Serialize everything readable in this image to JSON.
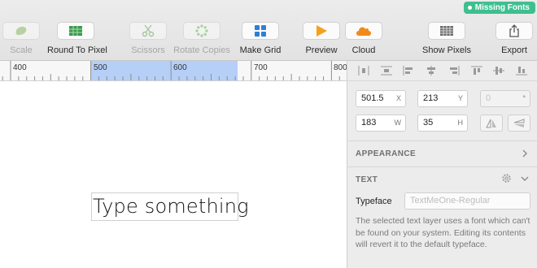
{
  "toolbar": {
    "items": [
      {
        "label": "Scale",
        "icon": "scale-icon",
        "enabled": false
      },
      {
        "label": "Round To Pixel",
        "icon": "round-to-pixel-icon",
        "enabled": true
      },
      {
        "label": "Scissors",
        "icon": "scissors-icon",
        "enabled": false
      },
      {
        "label": "Rotate Copies",
        "icon": "rotate-copies-icon",
        "enabled": false
      },
      {
        "label": "Make Grid",
        "icon": "make-grid-icon",
        "enabled": true
      },
      {
        "label": "Preview",
        "icon": "preview-icon",
        "enabled": true
      },
      {
        "label": "Cloud",
        "icon": "cloud-icon",
        "enabled": true
      },
      {
        "label": "Show Pixels",
        "icon": "show-pixels-icon",
        "enabled": true
      },
      {
        "label": "Export",
        "icon": "export-icon",
        "enabled": true
      }
    ],
    "missing_fonts": "Missing Fonts"
  },
  "ruler": {
    "labels": [
      "400",
      "500",
      "600",
      "700",
      "800"
    ]
  },
  "canvas": {
    "text_layer": "Type something"
  },
  "inspector": {
    "x": {
      "value": "501.5",
      "suffix": "X"
    },
    "y": {
      "value": "213",
      "suffix": "Y"
    },
    "rotation": {
      "value": "0",
      "suffix": "°"
    },
    "w": {
      "value": "183",
      "suffix": "W"
    },
    "h": {
      "value": "35",
      "suffix": "H"
    },
    "appearance_title": "APPEARANCE",
    "text_title": "TEXT",
    "typeface_label": "Typeface",
    "typeface_placeholder": "TextMeOne-Regular",
    "warning": "The selected text layer uses a font which can't be found on your system. Editing its contents will revert it to the default typeface."
  },
  "colors": {
    "missing_fonts_badge": "#3fbf8f",
    "ruler_selection": "#b5cff7"
  }
}
